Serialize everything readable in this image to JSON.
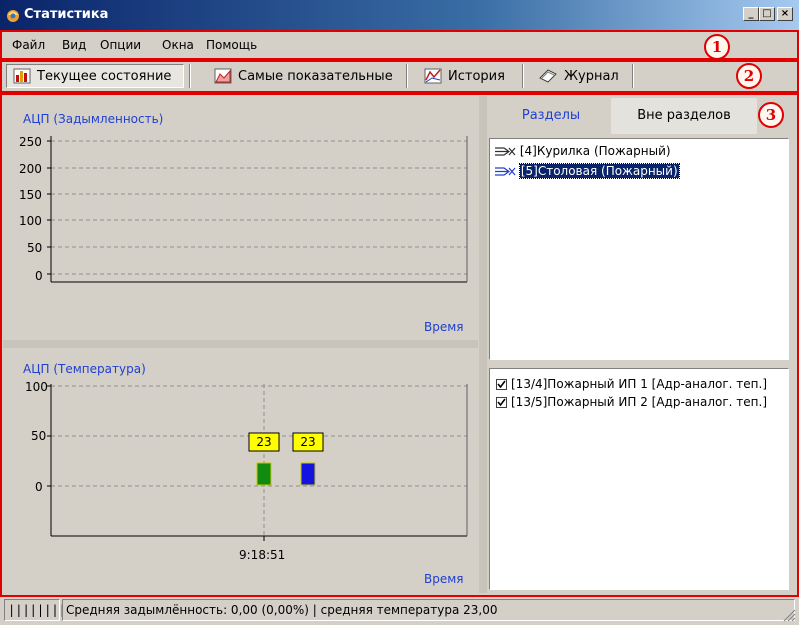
{
  "window": {
    "title": "Статистика"
  },
  "menu": {
    "items": [
      "Файл",
      "Вид",
      "Опции",
      "Окна",
      "Помощь"
    ]
  },
  "toolbar": {
    "buttons": [
      {
        "label": "Текущее состояние",
        "icon": "bar-chart-icon"
      },
      {
        "label": "Самые показательные",
        "icon": "area-chart-icon"
      },
      {
        "label": "История",
        "icon": "line-chart-icon"
      },
      {
        "label": "Журнал",
        "icon": "journal-icon"
      }
    ]
  },
  "markers": [
    "1",
    "2",
    "3"
  ],
  "chart_data": [
    {
      "type": "bar",
      "title": "АЦП (Задымленность)",
      "xlabel": "Время",
      "ylabel": "",
      "yticks": [
        250,
        200,
        150,
        100,
        50,
        0
      ],
      "ylim": [
        0,
        250
      ],
      "grid": true,
      "series": []
    },
    {
      "type": "bar",
      "title": "АЦП (Температура)",
      "xlabel": "Время",
      "ylabel": "",
      "yticks": [
        100,
        50,
        0
      ],
      "ylim": [
        -50,
        100
      ],
      "grid": true,
      "x_tick": "9:18:51",
      "series": [
        {
          "value": 23,
          "label": "23",
          "color": "#118a11"
        },
        {
          "value": 23,
          "label": "23",
          "color": "#1414e0"
        }
      ]
    }
  ],
  "tabs": {
    "sections": "Разделы",
    "outside": "Вне разделов"
  },
  "sections_list": [
    {
      "label": "[4]Курилка (Пожарный)",
      "selected": false
    },
    {
      "label": "[5]Столовая (Пожарный)",
      "selected": true
    }
  ],
  "sensors_list": [
    {
      "label": "[13/4]Пожарный ИП 1 [Адр-аналог. теп.]",
      "checked": true
    },
    {
      "label": "[13/5]Пожарный ИП 2 [Адр-аналог. теп.]",
      "checked": true
    }
  ],
  "status": {
    "grip": "||||||||",
    "text": "Средняя задымлённость: 0,00 (0,00%) | средняя температура 23,00"
  },
  "colors": {
    "chart_title": "#1f3fd0",
    "marker": "#e00000",
    "title_bar": "#0a246a"
  }
}
